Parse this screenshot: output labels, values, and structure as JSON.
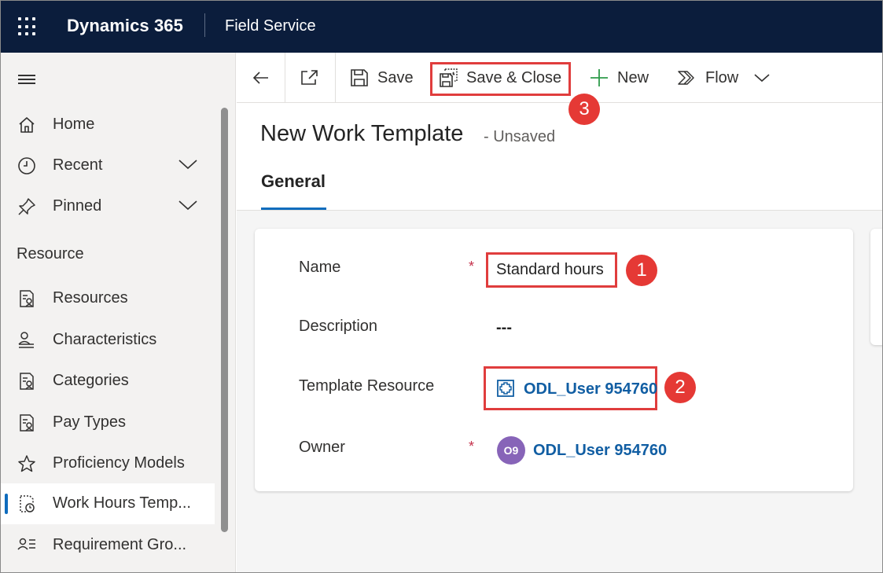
{
  "topbar": {
    "app_title": "Dynamics 365",
    "module_name": "Field Service"
  },
  "sidebar": {
    "items": [
      {
        "label": "Home",
        "icon": "home-icon"
      },
      {
        "label": "Recent",
        "icon": "clock-icon",
        "expandable": true
      },
      {
        "label": "Pinned",
        "icon": "pin-icon",
        "expandable": true
      }
    ],
    "section_title": "Resource",
    "section_items": [
      {
        "label": "Resources",
        "icon": "resource-list-icon"
      },
      {
        "label": "Characteristics",
        "icon": "characteristics-icon"
      },
      {
        "label": "Categories",
        "icon": "categories-icon"
      },
      {
        "label": "Pay Types",
        "icon": "pay-types-icon"
      },
      {
        "label": "Proficiency Models",
        "icon": "star-icon"
      },
      {
        "label": "Work Hours Temp...",
        "icon": "work-hours-icon",
        "active": true
      },
      {
        "label": "Requirement Gro...",
        "icon": "requirement-group-icon"
      }
    ]
  },
  "commandbar": {
    "save_label": "Save",
    "save_close_label": "Save & Close",
    "new_label": "New",
    "flow_label": "Flow"
  },
  "header": {
    "title": "New Work Template",
    "status": "- Unsaved",
    "tabs": [
      {
        "label": "General",
        "selected": true
      }
    ]
  },
  "form": {
    "name_label": "Name",
    "name_value": "Standard hours",
    "description_label": "Description",
    "description_value": "---",
    "template_resource_label": "Template Resource",
    "template_resource_value": "ODL_User 954760",
    "owner_label": "Owner",
    "owner_value": "ODL_User 954760",
    "owner_initials": "O9",
    "required_marker": "*"
  },
  "annotations": {
    "step1": "1",
    "step2": "2",
    "step3": "3",
    "highlight_color": "#e03d3d",
    "badge_color": "#e53935"
  },
  "colors": {
    "topbar_bg": "#0b1d3c",
    "accent": "#0f6cbd",
    "link": "#115ea3",
    "avatar": "#8764b8"
  }
}
